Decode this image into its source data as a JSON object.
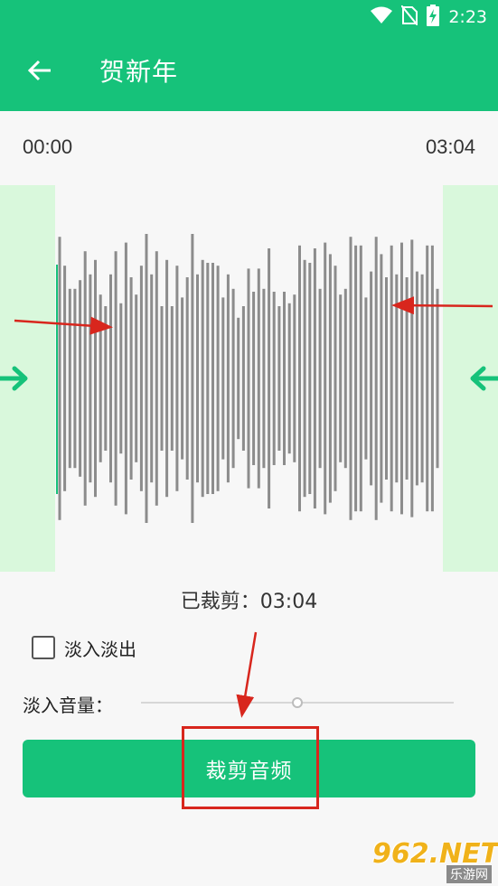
{
  "status_bar": {
    "time": "2:23",
    "icons": [
      "wifi-icon",
      "no-sim-icon",
      "battery-charging-icon"
    ]
  },
  "app_bar": {
    "back_icon": "arrow-back-icon",
    "title": "贺新年"
  },
  "editor": {
    "start_time": "00:00",
    "end_time": "03:04",
    "trimmed_label": "已裁剪：03:04",
    "fade_checkbox_label": "淡入淡出",
    "fade_checked": false,
    "fade_volume_label": "淡入音量：",
    "fade_volume_fraction": 0.5,
    "trim_button_label": "裁剪音频"
  },
  "colors": {
    "primary": "#16c27a",
    "trim_panel": "#d9f8dc",
    "waveform": "#8c8c8c",
    "annotation": "#d8261d"
  },
  "waveform": {
    "bar_heights": [
      0.98,
      0.78,
      0.62,
      0.62,
      0.68,
      0.88,
      0.72,
      0.82,
      0.58,
      0.5,
      0.72,
      0.88,
      0.52,
      0.94,
      0.7,
      0.58,
      0.78,
      1.0,
      0.72,
      0.88,
      0.5,
      0.82,
      0.5,
      0.78,
      0.56,
      0.7,
      1.0,
      0.72,
      0.82,
      0.8,
      0.8,
      0.78,
      0.56,
      0.72,
      0.62,
      0.42,
      0.5,
      0.76,
      0.6,
      0.76,
      0.62,
      0.9,
      0.6,
      0.5,
      0.6,
      0.52,
      0.58,
      0.92,
      0.82,
      0.8,
      0.9,
      0.62,
      0.94,
      0.86,
      0.78,
      0.58,
      0.62,
      0.98,
      0.92,
      0.92,
      0.56,
      0.74,
      0.98,
      0.86,
      0.7,
      0.92,
      0.72,
      0.94,
      0.7,
      0.96,
      0.74,
      0.72,
      0.92,
      0.92,
      0.62
    ]
  },
  "watermark": {
    "main": "962.NET",
    "sub": "乐游网"
  }
}
